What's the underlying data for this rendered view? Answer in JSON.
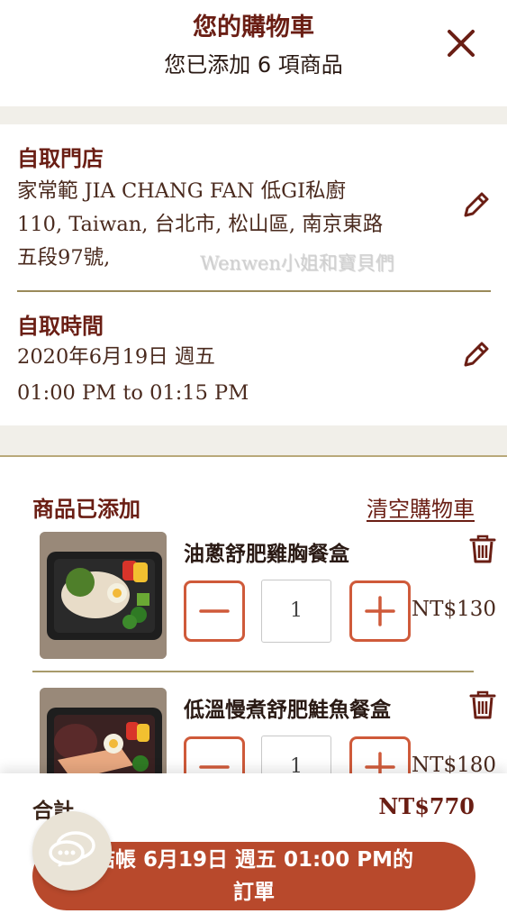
{
  "header": {
    "title": "您的購物車",
    "subtitle": "您已添加 6 項商品"
  },
  "pickup_store": {
    "label": "自取門店",
    "line1": "家常範 JIA CHANG FAN 低GI私廚",
    "line2": "110, Taiwan, 台北市, 松山區, 南京東路",
    "line3": "五段97號,"
  },
  "pickup_time": {
    "label": "自取時間",
    "date": "2020年6月19日 週五",
    "time": "01:00 PM to 01:15 PM"
  },
  "watermark": "Wenwen小姐和寶貝們",
  "items_section": {
    "title": "商品已添加",
    "clear_label": "清空購物車"
  },
  "items": [
    {
      "name": "油蔥舒肥雞胸餐盒",
      "qty": "1",
      "price": "NT$130"
    },
    {
      "name": "低溫慢煮舒肥鮭魚餐盒",
      "qty": "1",
      "price": "NT$180"
    }
  ],
  "footer": {
    "total_label": "合計",
    "total_value": "NT$770",
    "checkout_line1": "結帳 6月19日 週五 01:00 PM的",
    "checkout_line2": "訂單"
  },
  "colors": {
    "accent": "#6a1e14",
    "button": "#b8492c",
    "qty_border": "#cf5a3a"
  }
}
